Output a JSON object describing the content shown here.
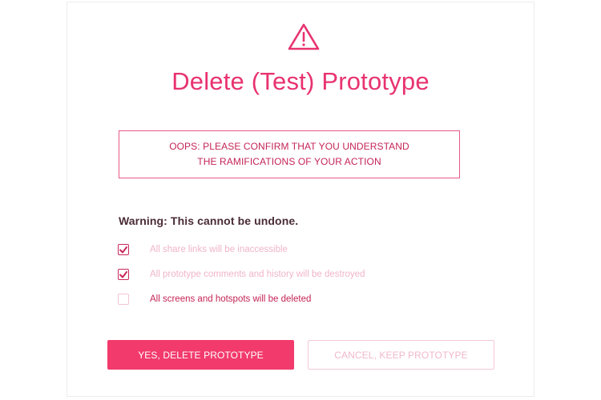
{
  "dialog": {
    "title": "Delete (Test) Prototype",
    "icon": "warning-triangle-icon",
    "alert_line_1": "OOPS: PLEASE CONFIRM THAT YOU UNDERSTAND",
    "alert_line_2": "THE RAMIFICATIONS OF YOUR ACTION",
    "warning_heading": "Warning: This cannot be undone.",
    "checklist": [
      {
        "label": "All share links will be inaccessible",
        "checked": true
      },
      {
        "label": "All prototype comments and history will be destroyed",
        "checked": true
      },
      {
        "label": "All screens and hotspots will be deleted",
        "checked": false
      }
    ],
    "confirm_label": "YES, DELETE PROTOTYPE",
    "cancel_label": "CANCEL, KEEP PROTOTYPE"
  },
  "colors": {
    "accent": "#e8336f",
    "button_primary": "#f23a6c",
    "muted_text": "#f0b5c8"
  }
}
